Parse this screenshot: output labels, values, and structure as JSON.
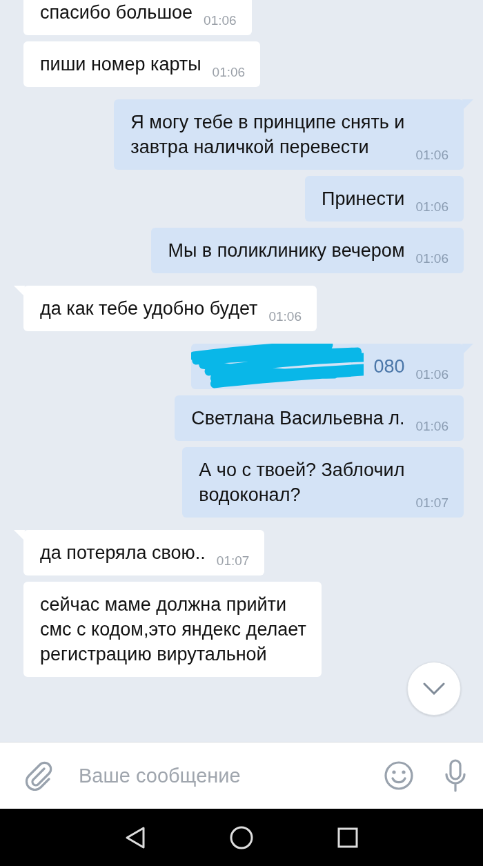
{
  "messages": [
    {
      "kind": "in",
      "text": "спасибо большое",
      "time": "01:06"
    },
    {
      "kind": "in",
      "text": "пиши номер карты",
      "time": "01:06",
      "tail": false
    },
    {
      "kind": "out",
      "text": "Я могу тебе в принципе снять и\nзавтра наличкой перевести",
      "time": "01:06",
      "tail": true
    },
    {
      "kind": "out",
      "text": "Принести",
      "time": "01:06",
      "tail": false
    },
    {
      "kind": "out",
      "text": "Мы в поликлинику вечером",
      "time": "01:06",
      "tail": false
    },
    {
      "kind": "in",
      "text": "да как тебе удобно будет",
      "time": "01:06",
      "tail": true
    },
    {
      "kind": "out",
      "text": "080",
      "time": "01:06",
      "tail": true,
      "redacted": true
    },
    {
      "kind": "out",
      "text": "Светлана Васильевна л.",
      "time": "01:06",
      "tail": false
    },
    {
      "kind": "out",
      "text": "А чо с твоей? Заблочил\nводоконал?",
      "time": "01:07",
      "tail": false
    },
    {
      "kind": "in",
      "text": "да потеряла свою..",
      "time": "01:07",
      "tail": true
    },
    {
      "kind": "in",
      "text": "сейчас маме должна прийти\nсмс с кодом,это яндекс делает\nрегистрацию вирутальной",
      "tail": false
    }
  ],
  "composer": {
    "placeholder": "Ваше сообщение"
  }
}
